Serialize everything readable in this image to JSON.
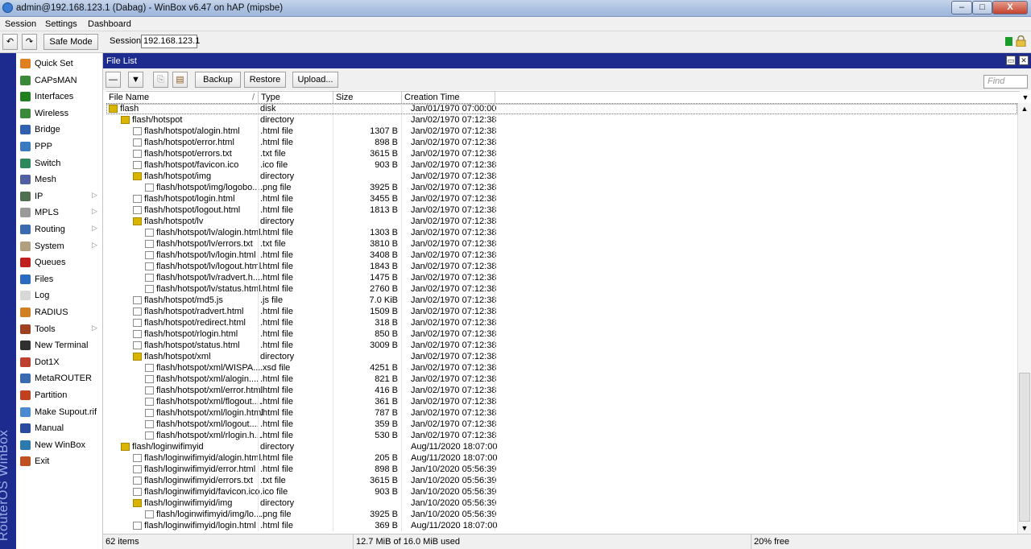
{
  "window": {
    "title": "admin@192.168.123.1 (Dabag) - WinBox v6.47 on hAP (mipsbe)",
    "minimize": "–",
    "maximize": "□",
    "close": "X"
  },
  "menu": [
    "Session",
    "Settings",
    "Dashboard"
  ],
  "toolbar": {
    "undo": "↶",
    "redo": "↷",
    "safe_mode": "Safe Mode",
    "session_label": "Session:",
    "session_value": "192.168.123.1"
  },
  "brand": "RouterOS WinBox",
  "sidebar": [
    {
      "label": "Quick Set",
      "icon": "quickset-icon",
      "color": "#e08020",
      "arrow": ""
    },
    {
      "label": "CAPsMAN",
      "icon": "capsman-icon",
      "color": "#3a8a3a",
      "arrow": ""
    },
    {
      "label": "Interfaces",
      "icon": "interfaces-icon",
      "color": "#208020",
      "arrow": ""
    },
    {
      "label": "Wireless",
      "icon": "wireless-icon",
      "color": "#3a8a3a",
      "arrow": ""
    },
    {
      "label": "Bridge",
      "icon": "bridge-icon",
      "color": "#3060b0",
      "arrow": ""
    },
    {
      "label": "PPP",
      "icon": "ppp-icon",
      "color": "#3a7ac0",
      "arrow": ""
    },
    {
      "label": "Switch",
      "icon": "switch-icon",
      "color": "#2a8a5a",
      "arrow": ""
    },
    {
      "label": "Mesh",
      "icon": "mesh-icon",
      "color": "#5060a0",
      "arrow": ""
    },
    {
      "label": "IP",
      "icon": "ip-icon",
      "color": "#507050",
      "arrow": "▷"
    },
    {
      "label": "MPLS",
      "icon": "mpls-icon",
      "color": "#9a9a9a",
      "arrow": "▷"
    },
    {
      "label": "Routing",
      "icon": "routing-icon",
      "color": "#3a6ab0",
      "arrow": "▷"
    },
    {
      "label": "System",
      "icon": "system-icon",
      "color": "#b0a080",
      "arrow": "▷"
    },
    {
      "label": "Queues",
      "icon": "queues-icon",
      "color": "#c02020",
      "arrow": ""
    },
    {
      "label": "Files",
      "icon": "files-icon",
      "color": "#2a6ac0",
      "arrow": ""
    },
    {
      "label": "Log",
      "icon": "log-icon",
      "color": "#d8d8d8",
      "arrow": ""
    },
    {
      "label": "RADIUS",
      "icon": "radius-icon",
      "color": "#d08020",
      "arrow": ""
    },
    {
      "label": "Tools",
      "icon": "tools-icon",
      "color": "#a04020",
      "arrow": "▷"
    },
    {
      "label": "New Terminal",
      "icon": "terminal-icon",
      "color": "#303030",
      "arrow": ""
    },
    {
      "label": "Dot1X",
      "icon": "dot1x-icon",
      "color": "#c04030",
      "arrow": ""
    },
    {
      "label": "MetaROUTER",
      "icon": "metarouter-icon",
      "color": "#3a6ab0",
      "arrow": ""
    },
    {
      "label": "Partition",
      "icon": "partition-icon",
      "color": "#c04020",
      "arrow": ""
    },
    {
      "label": "Make Supout.rif",
      "icon": "supout-icon",
      "color": "#4a8ad0",
      "arrow": ""
    },
    {
      "label": "Manual",
      "icon": "manual-icon",
      "color": "#2a4aa0",
      "arrow": ""
    },
    {
      "label": "New WinBox",
      "icon": "winbox-icon",
      "color": "#2a7ab0",
      "arrow": ""
    },
    {
      "label": "Exit",
      "icon": "exit-icon",
      "color": "#c05020",
      "arrow": ""
    }
  ],
  "file_window": {
    "title": "File List",
    "buttons": {
      "remove": "—",
      "filter": "▼",
      "copy": "⎘",
      "paste": "▤",
      "backup": "Backup",
      "restore": "Restore",
      "upload": "Upload..."
    },
    "find_placeholder": "Find",
    "columns": [
      "File Name",
      "Type",
      "Size",
      "Creation Time"
    ],
    "sort_indicator": "/",
    "rows": [
      {
        "name": "flash",
        "type": "disk",
        "size": "",
        "time": "Jan/01/1970 07:00:00",
        "kind": "disk",
        "indent": 0
      },
      {
        "name": "flash/hotspot",
        "type": "directory",
        "size": "",
        "time": "Jan/02/1970 07:12:38",
        "kind": "dir",
        "indent": 1
      },
      {
        "name": "flash/hotspot/alogin.html",
        "type": ".html file",
        "size": "1307 B",
        "time": "Jan/02/1970 07:12:38",
        "kind": "file",
        "indent": 2
      },
      {
        "name": "flash/hotspot/error.html",
        "type": ".html file",
        "size": "898 B",
        "time": "Jan/02/1970 07:12:38",
        "kind": "file",
        "indent": 2
      },
      {
        "name": "flash/hotspot/errors.txt",
        "type": ".txt file",
        "size": "3615 B",
        "time": "Jan/02/1970 07:12:38",
        "kind": "file",
        "indent": 2
      },
      {
        "name": "flash/hotspot/favicon.ico",
        "type": ".ico file",
        "size": "903 B",
        "time": "Jan/02/1970 07:12:38",
        "kind": "file",
        "indent": 2
      },
      {
        "name": "flash/hotspot/img",
        "type": "directory",
        "size": "",
        "time": "Jan/02/1970 07:12:38",
        "kind": "dir",
        "indent": 2
      },
      {
        "name": "flash/hotspot/img/logobo...",
        "type": ".png file",
        "size": "3925 B",
        "time": "Jan/02/1970 07:12:38",
        "kind": "file",
        "indent": 3
      },
      {
        "name": "flash/hotspot/login.html",
        "type": ".html file",
        "size": "3455 B",
        "time": "Jan/02/1970 07:12:38",
        "kind": "file",
        "indent": 2
      },
      {
        "name": "flash/hotspot/logout.html",
        "type": ".html file",
        "size": "1813 B",
        "time": "Jan/02/1970 07:12:38",
        "kind": "file",
        "indent": 2
      },
      {
        "name": "flash/hotspot/lv",
        "type": "directory",
        "size": "",
        "time": "Jan/02/1970 07:12:38",
        "kind": "dir",
        "indent": 2
      },
      {
        "name": "flash/hotspot/lv/alogin.html",
        "type": ".html file",
        "size": "1303 B",
        "time": "Jan/02/1970 07:12:38",
        "kind": "file",
        "indent": 3
      },
      {
        "name": "flash/hotspot/lv/errors.txt",
        "type": ".txt file",
        "size": "3810 B",
        "time": "Jan/02/1970 07:12:38",
        "kind": "file",
        "indent": 3
      },
      {
        "name": "flash/hotspot/lv/login.html",
        "type": ".html file",
        "size": "3408 B",
        "time": "Jan/02/1970 07:12:38",
        "kind": "file",
        "indent": 3
      },
      {
        "name": "flash/hotspot/lv/logout.html",
        "type": ".html file",
        "size": "1843 B",
        "time": "Jan/02/1970 07:12:38",
        "kind": "file",
        "indent": 3
      },
      {
        "name": "flash/hotspot/lv/radvert.h...",
        "type": ".html file",
        "size": "1475 B",
        "time": "Jan/02/1970 07:12:38",
        "kind": "file",
        "indent": 3
      },
      {
        "name": "flash/hotspot/lv/status.html",
        "type": ".html file",
        "size": "2760 B",
        "time": "Jan/02/1970 07:12:38",
        "kind": "file",
        "indent": 3
      },
      {
        "name": "flash/hotspot/md5.js",
        "type": ".js file",
        "size": "7.0 KiB",
        "time": "Jan/02/1970 07:12:38",
        "kind": "file",
        "indent": 2
      },
      {
        "name": "flash/hotspot/radvert.html",
        "type": ".html file",
        "size": "1509 B",
        "time": "Jan/02/1970 07:12:38",
        "kind": "file",
        "indent": 2
      },
      {
        "name": "flash/hotspot/redirect.html",
        "type": ".html file",
        "size": "318 B",
        "time": "Jan/02/1970 07:12:38",
        "kind": "file",
        "indent": 2
      },
      {
        "name": "flash/hotspot/rlogin.html",
        "type": ".html file",
        "size": "850 B",
        "time": "Jan/02/1970 07:12:38",
        "kind": "file",
        "indent": 2
      },
      {
        "name": "flash/hotspot/status.html",
        "type": ".html file",
        "size": "3009 B",
        "time": "Jan/02/1970 07:12:38",
        "kind": "file",
        "indent": 2
      },
      {
        "name": "flash/hotspot/xml",
        "type": "directory",
        "size": "",
        "time": "Jan/02/1970 07:12:38",
        "kind": "dir",
        "indent": 2
      },
      {
        "name": "flash/hotspot/xml/WISPA...",
        "type": ".xsd file",
        "size": "4251 B",
        "time": "Jan/02/1970 07:12:38",
        "kind": "file",
        "indent": 3
      },
      {
        "name": "flash/hotspot/xml/alogin....",
        "type": ".html file",
        "size": "821 B",
        "time": "Jan/02/1970 07:12:38",
        "kind": "file",
        "indent": 3
      },
      {
        "name": "flash/hotspot/xml/error.html",
        "type": ".html file",
        "size": "416 B",
        "time": "Jan/02/1970 07:12:38",
        "kind": "file",
        "indent": 3
      },
      {
        "name": "flash/hotspot/xml/flogout....",
        "type": ".html file",
        "size": "361 B",
        "time": "Jan/02/1970 07:12:38",
        "kind": "file",
        "indent": 3
      },
      {
        "name": "flash/hotspot/xml/login.html",
        "type": ".html file",
        "size": "787 B",
        "time": "Jan/02/1970 07:12:38",
        "kind": "file",
        "indent": 3
      },
      {
        "name": "flash/hotspot/xml/logout....",
        "type": ".html file",
        "size": "359 B",
        "time": "Jan/02/1970 07:12:38",
        "kind": "file",
        "indent": 3
      },
      {
        "name": "flash/hotspot/xml/rlogin.h...",
        "type": ".html file",
        "size": "530 B",
        "time": "Jan/02/1970 07:12:38",
        "kind": "file",
        "indent": 3
      },
      {
        "name": "flash/loginwifimyid",
        "type": "directory",
        "size": "",
        "time": "Aug/11/2020 18:07:00",
        "kind": "dir",
        "indent": 1
      },
      {
        "name": "flash/loginwifimyid/alogin.html",
        "type": ".html file",
        "size": "205 B",
        "time": "Aug/11/2020 18:07:00",
        "kind": "file",
        "indent": 2
      },
      {
        "name": "flash/loginwifimyid/error.html",
        "type": ".html file",
        "size": "898 B",
        "time": "Jan/10/2020 05:56:39",
        "kind": "file",
        "indent": 2
      },
      {
        "name": "flash/loginwifimyid/errors.txt",
        "type": ".txt file",
        "size": "3615 B",
        "time": "Jan/10/2020 05:56:39",
        "kind": "file",
        "indent": 2
      },
      {
        "name": "flash/loginwifimyid/favicon.ico",
        "type": ".ico file",
        "size": "903 B",
        "time": "Jan/10/2020 05:56:39",
        "kind": "file",
        "indent": 2
      },
      {
        "name": "flash/loginwifimyid/img",
        "type": "directory",
        "size": "",
        "time": "Jan/10/2020 05:56:39",
        "kind": "dir",
        "indent": 2
      },
      {
        "name": "flash/loginwifimyid/img/lo...",
        "type": ".png file",
        "size": "3925 B",
        "time": "Jan/10/2020 05:56:39",
        "kind": "file",
        "indent": 3
      },
      {
        "name": "flash/loginwifimyid/login.html",
        "type": ".html file",
        "size": "369 B",
        "time": "Aug/11/2020 18:07:00",
        "kind": "file",
        "indent": 2
      }
    ],
    "status": {
      "items": "62 items",
      "used": "12.7 MiB of 16.0 MiB used",
      "free": "20% free"
    }
  },
  "colors": {
    "window_blue": "#1d2b8f",
    "status_green": "#1a9c2a"
  }
}
